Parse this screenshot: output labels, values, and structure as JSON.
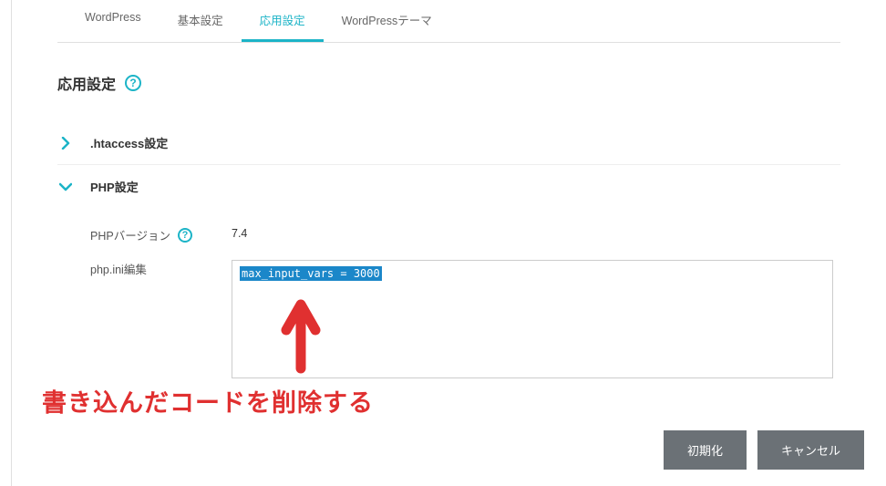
{
  "tabs": {
    "wordpress": "WordPress",
    "basic": "基本設定",
    "advanced": "応用設定",
    "theme": "WordPressテーマ"
  },
  "page_title": "応用設定",
  "sections": {
    "htaccess": ".htaccess設定",
    "php": "PHP設定"
  },
  "php_settings": {
    "version_label": "PHPバージョン",
    "version_value": "7.4",
    "ini_label": "php.ini編集",
    "ini_content": "max_input_vars = 3000"
  },
  "buttons": {
    "reset": "初期化",
    "cancel": "キャンセル"
  },
  "annotation": "書き込んだコードを削除する"
}
